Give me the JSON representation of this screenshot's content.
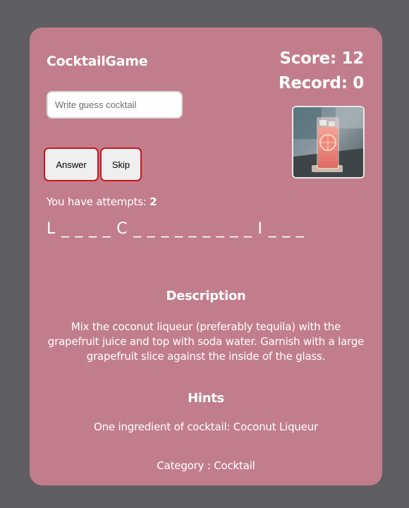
{
  "app": {
    "title": "CocktailGame"
  },
  "score": {
    "label": "Score: 12",
    "record_label": "Record: 0"
  },
  "guess": {
    "placeholder": "Write guess cocktail",
    "value": ""
  },
  "buttons": {
    "answer_label": "Answer",
    "skip_label": "Skip"
  },
  "attempts": {
    "prefix": "You have attempts: ",
    "count": "2"
  },
  "word_mask": "L _ _ _ _ C _ _ _ _ _ _ _ _ _ I _ _ _",
  "description": {
    "title": "Description",
    "text": "Mix the coconut liqueur (preferably tequila) with the grapefruit juice and top with soda water. Garnish with a large grapefruit slice against the inside of the glass."
  },
  "hints": {
    "title": "Hints",
    "text": "One ingredient of cocktail: Coconut Liqueur"
  },
  "category": {
    "text": "Category : Cocktail"
  },
  "colors": {
    "background": "#5f5e63",
    "card": "#c27d8c",
    "button_border": "#c8161d",
    "text": "#ffffff"
  },
  "icons": {
    "cocktail_photo": "cocktail-photo-icon"
  }
}
